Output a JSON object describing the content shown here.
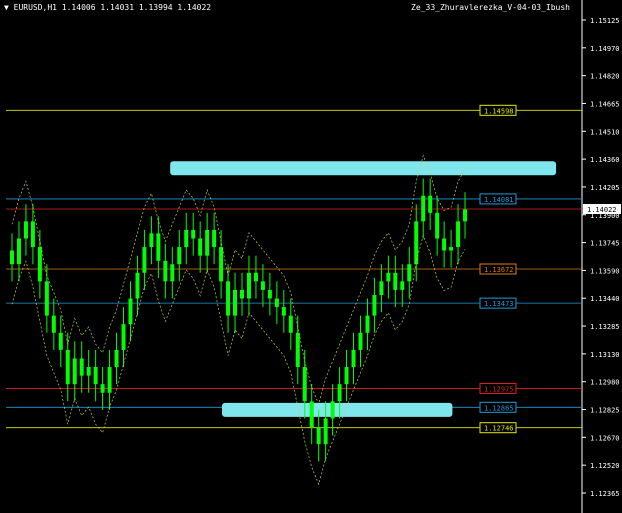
{
  "header": {
    "symbol_info": "▼ EURUSD,H1  1.14006 1.14031 1.13994 1.14022",
    "indicator_name": "Ze_33_Zhuravlerezka_V-04-03_Ibush"
  },
  "colors": {
    "background": "#000000",
    "candle": "#00ff00",
    "axis": "#ffffff",
    "gold_level": "#e6e600",
    "blue_level": "#1e9bdc",
    "orange_level": "#e07a1e",
    "red_level": "#e02020",
    "zone": "#7fe6ee",
    "channel": "#c8d23c",
    "price_box": "#ffffff"
  },
  "chart_data": {
    "type": "candlestick",
    "y_axis_ticks": [
      "1.15125",
      "1.14970",
      "1.14820",
      "1.14665",
      "1.14510",
      "1.14360",
      "1.14205",
      "1.13900",
      "1.13745",
      "1.13590",
      "1.13440",
      "1.13285",
      "1.13130",
      "1.12980",
      "1.12825",
      "1.12670",
      "1.12520",
      "1.12365"
    ],
    "ylim": [
      1.1229,
      1.152
    ],
    "current_price": "1.14022",
    "level_labels": [
      {
        "price": 1.14598,
        "text": "1.14598",
        "kind": "gold"
      },
      {
        "price": 1.14081,
        "text": "1.14081",
        "kind": "blue"
      },
      {
        "price": 1.13672,
        "text": "1.13672",
        "kind": "orange"
      },
      {
        "price": 1.13473,
        "text": "1.13473",
        "kind": "blue"
      },
      {
        "price": 1.12975,
        "text": "1.12975",
        "kind": "red"
      },
      {
        "price": 1.12865,
        "text": "1.12865",
        "kind": "blue"
      },
      {
        "price": 1.12746,
        "text": "1.12746",
        "kind": "gold"
      }
    ],
    "zones": [
      {
        "price": 1.1426,
        "x_from": 0.285,
        "x_to": 0.955
      },
      {
        "price": 1.1285,
        "x_from": 0.375,
        "x_to": 0.775
      }
    ],
    "close_series": [
      1.137,
      1.1385,
      1.1395,
      1.138,
      1.136,
      1.134,
      1.133,
      1.132,
      1.13,
      1.1315,
      1.1305,
      1.131,
      1.13,
      1.1295,
      1.131,
      1.132,
      1.1335,
      1.135,
      1.1365,
      1.138,
      1.1388,
      1.1372,
      1.136,
      1.137,
      1.138,
      1.139,
      1.1385,
      1.1375,
      1.139,
      1.138,
      1.136,
      1.134,
      1.1355,
      1.135,
      1.1365,
      1.136,
      1.1355,
      1.135,
      1.1345,
      1.134,
      1.133,
      1.131,
      1.129,
      1.1275,
      1.1265,
      1.128,
      1.129,
      1.13,
      1.131,
      1.132,
      1.133,
      1.134,
      1.1352,
      1.136,
      1.1365,
      1.1355,
      1.136,
      1.137,
      1.1395,
      1.141,
      1.14,
      1.1385,
      1.1378,
      1.138,
      1.1395,
      1.1402
    ]
  }
}
